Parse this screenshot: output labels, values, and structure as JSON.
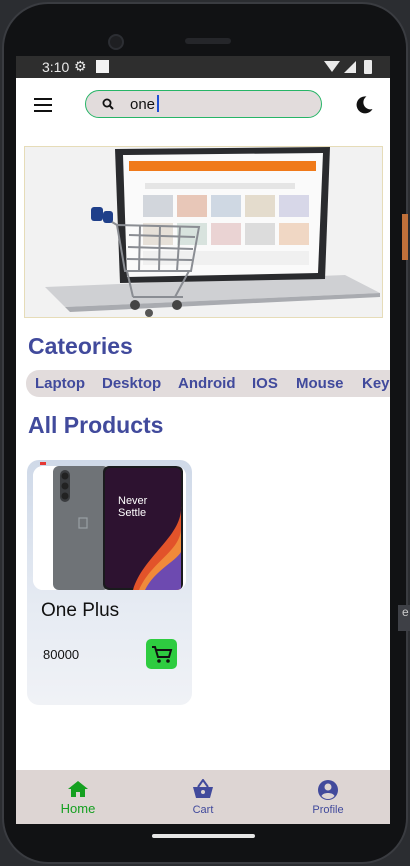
{
  "status_bar": {
    "time": "3:10"
  },
  "search": {
    "value": "one"
  },
  "sections": {
    "categories_title": "Cateories",
    "products_title": "All Products"
  },
  "categories": [
    "Laptop",
    "Desktop",
    "Android",
    "IOS",
    "Mouse",
    "Keyb"
  ],
  "products": [
    {
      "name": "One Plus",
      "price": "80000",
      "image_text": [
        "Never",
        "Settle"
      ]
    }
  ],
  "bottom_nav": [
    {
      "label": "Home",
      "icon": "home-icon",
      "active": true
    },
    {
      "label": "Cart",
      "icon": "basket-icon",
      "active": false
    },
    {
      "label": "Profile",
      "icon": "account-circle-icon",
      "active": false
    }
  ],
  "colors": {
    "accent_purple": "#414a9c",
    "active_green": "#15a020",
    "cart_green": "#2ecc40",
    "search_border": "#27b567",
    "nav_bg": "#ddd5d3"
  }
}
